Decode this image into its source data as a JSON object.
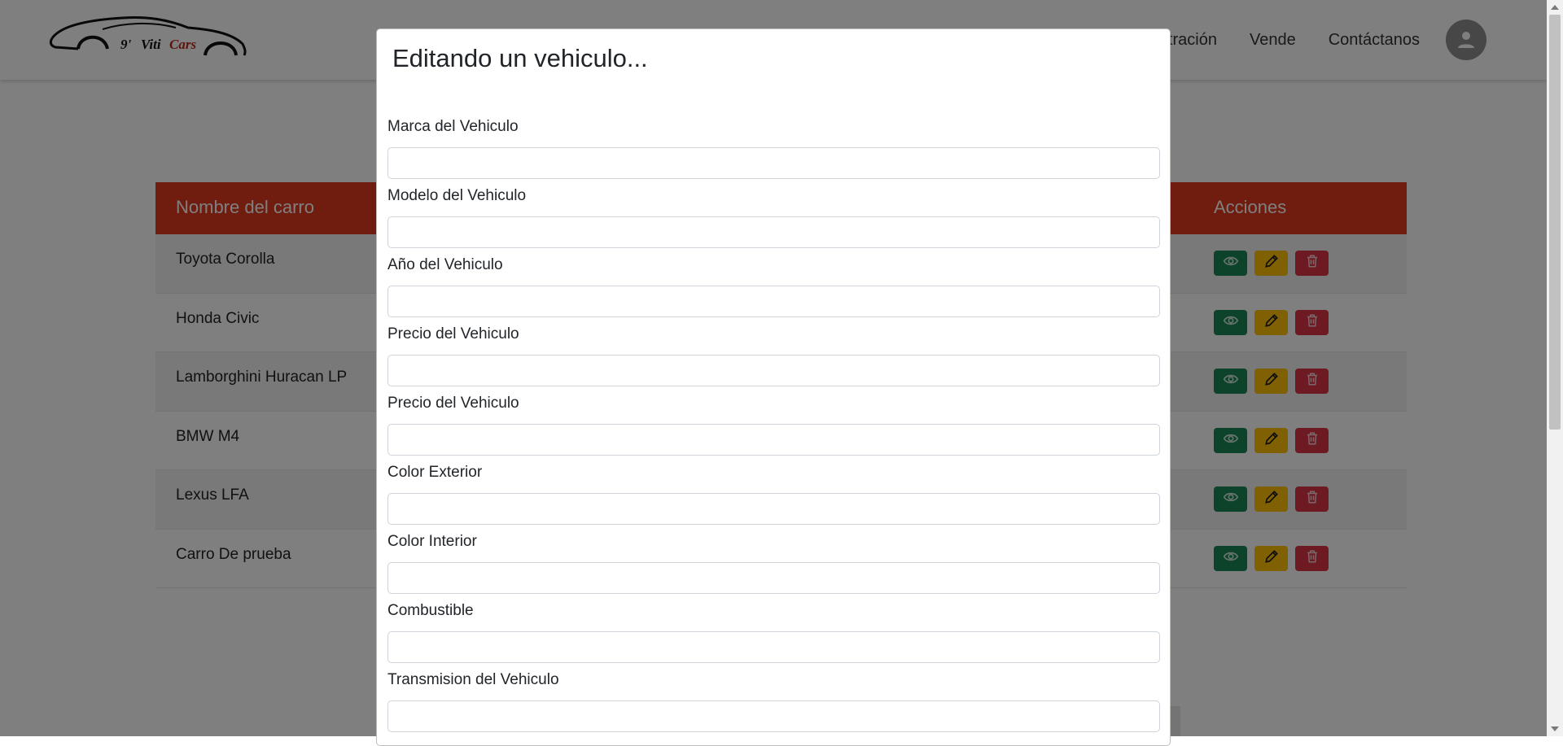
{
  "brand": {
    "logo_text_a": "9'",
    "logo_text_b": "Viti",
    "logo_text_c": "Cars"
  },
  "nav": {
    "items": [
      {
        "label": "nistración"
      },
      {
        "label": "Vende"
      },
      {
        "label": "Contáctanos"
      }
    ],
    "avatar_icon": "user-avatar-icon"
  },
  "table": {
    "headers": {
      "name": "Nombre del carro",
      "actions": "Acciones"
    },
    "rows": [
      {
        "name": "Toyota Corolla"
      },
      {
        "name": "Honda Civic"
      },
      {
        "name": "Lamborghini Huracan LP"
      },
      {
        "name": "BMW M4"
      },
      {
        "name": "Lexus LFA"
      },
      {
        "name": "Carro De prueba"
      }
    ],
    "action_icons": [
      "eye-icon",
      "pencil-icon",
      "trash-icon"
    ]
  },
  "modal": {
    "title": "Editando un vehiculo...",
    "fields": [
      {
        "label": "Marca del Vehiculo",
        "value": ""
      },
      {
        "label": "Modelo del Vehiculo",
        "value": ""
      },
      {
        "label": "Año del Vehiculo",
        "value": ""
      },
      {
        "label": "Precio del Vehiculo",
        "value": ""
      },
      {
        "label": "Precio del Vehiculo",
        "value": ""
      },
      {
        "label": "Color Exterior",
        "value": ""
      },
      {
        "label": "Color Interior",
        "value": ""
      },
      {
        "label": "Combustible",
        "value": ""
      },
      {
        "label": "Transmision del Vehiculo",
        "value": ""
      }
    ]
  },
  "colors": {
    "table_header": "#e0391e",
    "view_button": "#198754",
    "edit_button": "#ffc107",
    "delete_button": "#dc3545"
  }
}
